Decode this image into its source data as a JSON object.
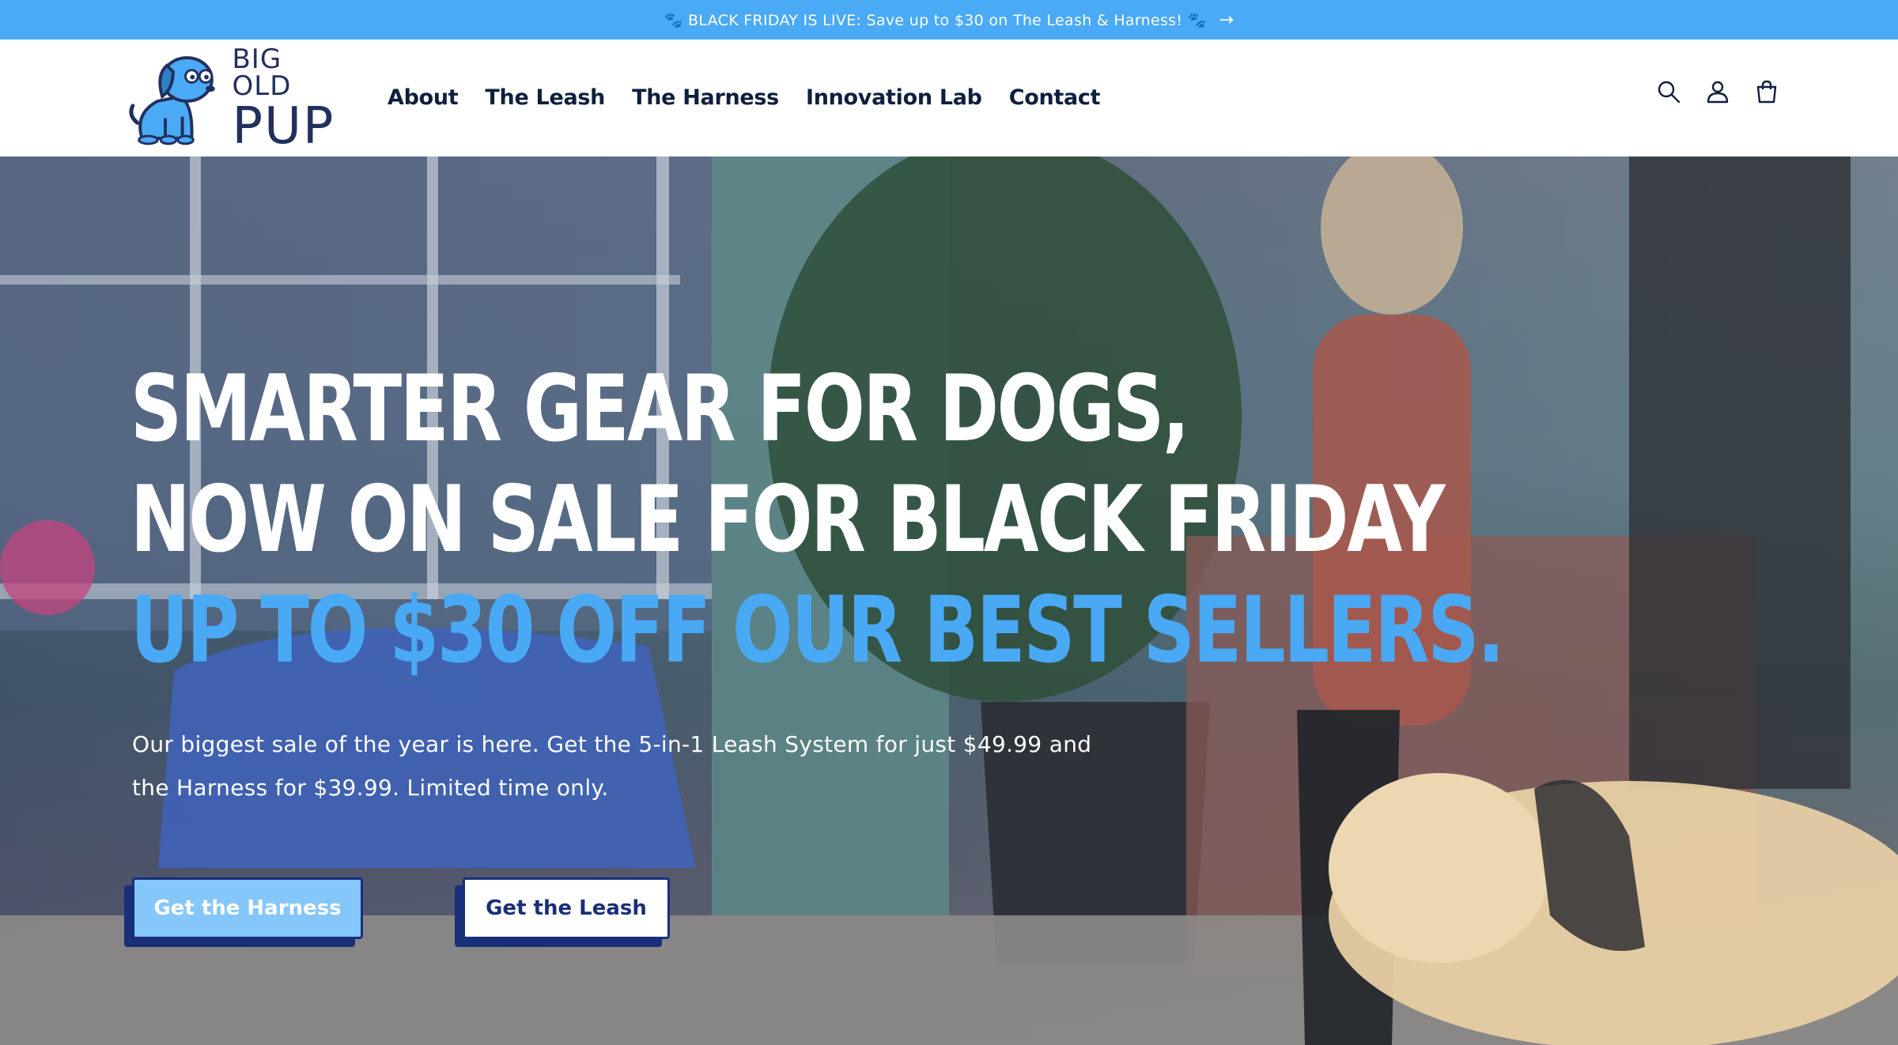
{
  "announcement": {
    "text": "🐾 BLACK FRIDAY IS LIVE: Save up to $30 on The Leash & Harness! 🐾",
    "arrow_icon": "arrow-right-icon"
  },
  "header": {
    "logo": {
      "line1": "BIG OLD",
      "line2": "PUP"
    },
    "nav": [
      {
        "label": "About"
      },
      {
        "label": "The Leash"
      },
      {
        "label": "The Harness"
      },
      {
        "label": "Innovation Lab"
      },
      {
        "label": "Contact"
      }
    ],
    "icons": [
      "search-icon",
      "account-icon",
      "cart-icon"
    ]
  },
  "hero": {
    "headline": {
      "line1": "SMARTER GEAR FOR DOGS,",
      "line2": "NOW ON SALE FOR BLACK FRIDAY",
      "line3": "UP TO $30 OFF OUR BEST SELLERS."
    },
    "subtext": "Our biggest sale of the year is here. Get the 5-in-1 Leash System for just $49.99 and the Harness for $39.99. Limited time only.",
    "buttons": {
      "harness": "Get the Harness",
      "leash": "Get the Leash"
    }
  },
  "colors": {
    "announcement_bg": "#4aaaf5",
    "navy": "#1a2f7a",
    "headline_blue": "#49a9f4",
    "harness_btn_bg": "#85c6fb"
  }
}
